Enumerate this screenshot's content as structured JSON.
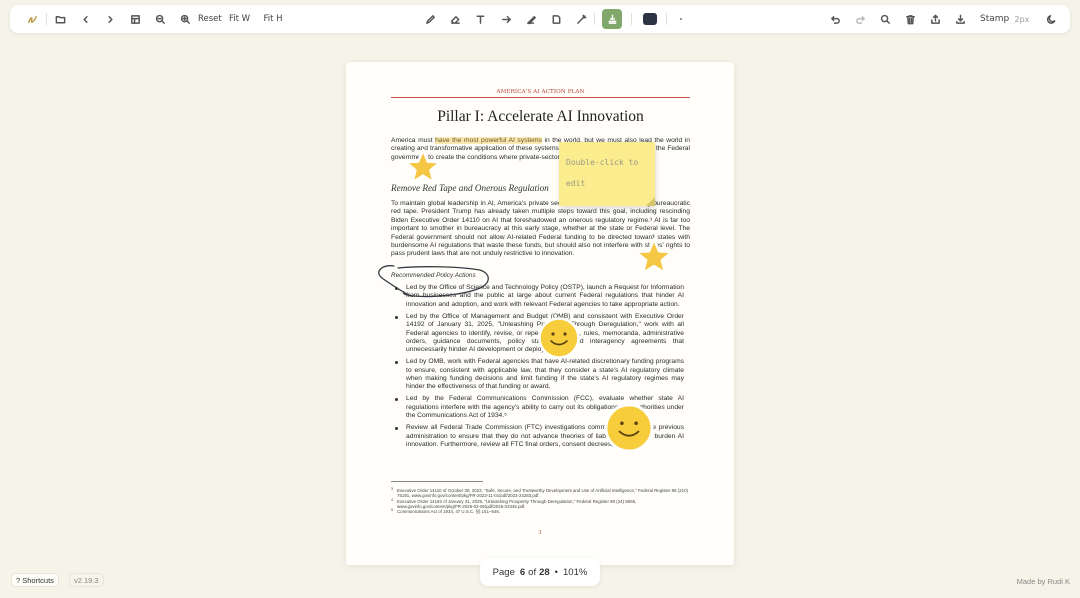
{
  "toolbar": {
    "reset_label": "Reset",
    "fit_width_label": "Fit W",
    "fit_height_label": "Fit H",
    "stamp_label": "Stamp",
    "stroke_size": "2px",
    "active_tool": "stamp",
    "current_color": "#2c3444",
    "icons": [
      "signature-icon",
      "open-file-icon",
      "prev-page-icon",
      "next-page-icon",
      "thumbnails-icon",
      "zoom-out-icon",
      "zoom-in-icon",
      "pen-icon",
      "eraser-icon",
      "text-icon",
      "arrow-icon",
      "highlighter-icon",
      "note-icon",
      "magic-icon",
      "stamp-icon",
      "color-swatch",
      "more-icon",
      "undo-icon",
      "redo-icon",
      "search-icon",
      "delete-icon",
      "share-icon",
      "download-icon",
      "theme-icon"
    ]
  },
  "document": {
    "header": "AMERICA'S AI ACTION PLAN",
    "title": "Pillar I: Accelerate AI Innovation",
    "intro_pre": "America must ",
    "intro_highlight": "have the most powerful AI systems",
    "intro_post": " in the world, but we must also lead the world in creating and transformative application of these systems. Achieving these goals requires the Federal government to create the conditions where private-sector-led innovation can flourish.",
    "section_heading": "Remove Red Tape and Onerous Regulation",
    "section_body": "To maintain global leadership in AI, America's private sector must be unencumbered by bureaucratic red tape. President Trump has already taken multiple steps toward this goal, including rescinding Biden Executive Order 14110 on AI that foreshadowed an onerous regulatory regime.³ AI is far too important to smother in bureaucracy at this early stage, whether at the state or Federal level. The Federal government should not allow AI-related Federal funding to be directed toward states with burdensome AI regulations that waste these funds, but should also not interfere with states' rights to pass prudent laws that are not unduly restrictive to innovation.",
    "recommended_label": "Recommended Policy Actions",
    "bullets": [
      "Led by the Office of Science and Technology Policy (OSTP), launch a Request for Information from businesses and the public at large about current Federal regulations that hinder AI innovation and adoption, and work with relevant Federal agencies to take appropriate action.",
      "Led by the Office of Management and Budget (OMB) and consistent with Executive Order 14192 of January 31, 2025, \"Unleashing Prosperity Through Deregulation,\" work with all Federal agencies to identify, revise, or repeal regulations, rules, memoranda, administrative orders, guidance documents, policy statements, and interagency agreements that unnecessarily hinder AI development or deployment.⁴",
      "Led by OMB, work with Federal agencies that have AI-related discretionary funding programs to ensure, consistent with applicable law, that they consider a state's AI regulatory climate when making funding decisions and limit funding if the state's AI regulatory regimes may hinder the effectiveness of that funding or award.",
      "Led by the Federal Communications Commission (FCC), evaluate whether state AI regulations interfere with the agency's ability to carry out its obligations and authorities under the Communications Act of 1934.⁵",
      "Review all Federal Trade Commission (FTC) investigations commenced under the previous administration to ensure that they do not advance theories of liability that unduly burden AI innovation. Furthermore, review all FTC final orders, consent decrees,"
    ],
    "footnotes": [
      {
        "mark": "3",
        "text": "Executive Order 14110 of October 30, 2023, \"Safe, Secure, and Trustworthy Development and Use of Artificial Intelligence,\" Federal Register 88 (210) 75191, www.govinfo.gov/content/pkg/FR-2023-11-01/pdf/2023-24283.pdf."
      },
      {
        "mark": "4",
        "text": "Executive Order 14192 of January 31, 2025, \"Unleashing Prosperity Through Deregulation,\" Federal Register 90 (24) 9065, www.govinfo.gov/content/pkg/FR-2025-02-06/pdf/2025-02345.pdf."
      },
      {
        "mark": "5",
        "text": "Communications Act of 1934, 47 U.S.C. §§ 151–646."
      }
    ],
    "page_number": "3"
  },
  "annotations": {
    "sticky_note_text": "Double-click to edit",
    "note_color": "#fbec8e",
    "stamp_types": [
      "star",
      "star",
      "smiley",
      "smiley"
    ],
    "ink_color": "#3a3a44"
  },
  "page_indicator": {
    "page_label": "Page",
    "current": "6",
    "of_label": "of",
    "total": "28",
    "separator": "•",
    "zoom": "101%"
  },
  "footer": {
    "shortcuts_label": "? Shortcuts",
    "version": "v2.19.3",
    "made_by": "Made by Rudi K"
  }
}
